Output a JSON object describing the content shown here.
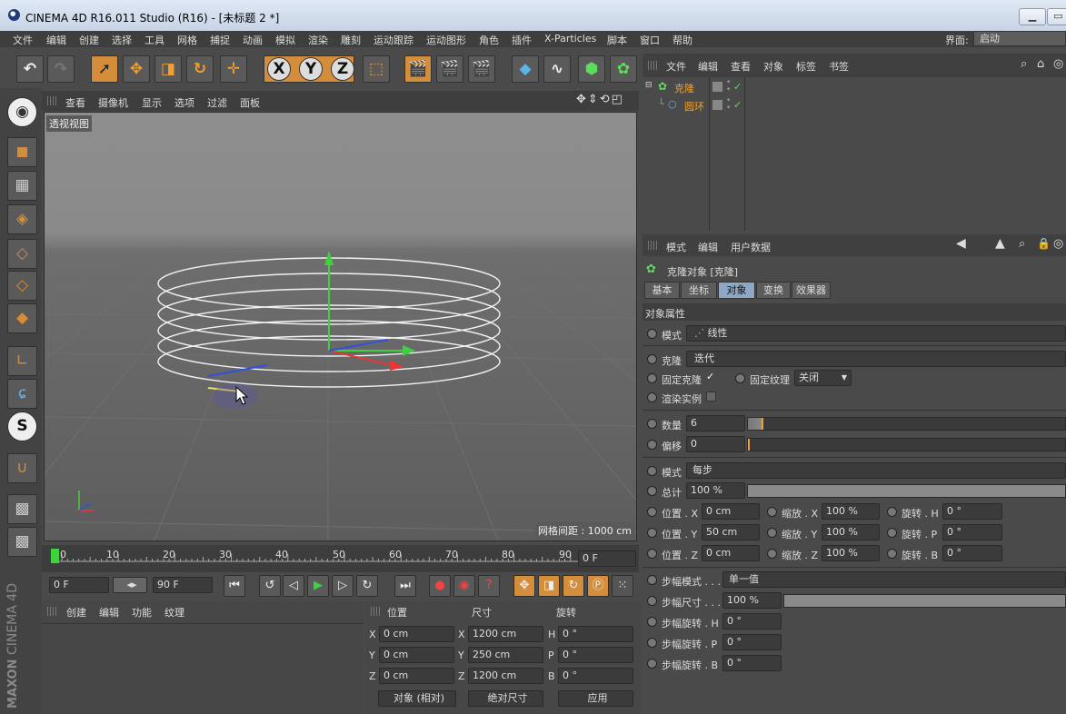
{
  "window": {
    "title": "CINEMA 4D R16.011 Studio (R16) - [未标题 2 *]"
  },
  "menubar": {
    "items": [
      "文件",
      "编辑",
      "创建",
      "选择",
      "工具",
      "网格",
      "捕捉",
      "动画",
      "模拟",
      "渲染",
      "雕刻",
      "运动跟踪",
      "运动图形",
      "角色",
      "插件",
      "X-Particles",
      "脚本",
      "窗口",
      "帮助"
    ],
    "layout_label": "界面:",
    "layout_value": "启动"
  },
  "toolbar": {
    "x": "X",
    "y": "Y",
    "z": "Z"
  },
  "sidebar": {
    "s_label": "S"
  },
  "viewport": {
    "menu": [
      "查看",
      "摄像机",
      "显示",
      "选项",
      "过滤",
      "面板"
    ],
    "view_name": "透视视图",
    "grid_info": "网格间距 : 1000 cm"
  },
  "timeline": {
    "ticks": [
      "0",
      "10",
      "20",
      "30",
      "40",
      "50",
      "60",
      "70",
      "80",
      "90"
    ],
    "current_frame": "0 F"
  },
  "playback": {
    "start": "0 F",
    "end": "90 F"
  },
  "materials": {
    "menu": [
      "创建",
      "编辑",
      "功能",
      "纹理"
    ]
  },
  "coords": {
    "headers": [
      "位置",
      "尺寸",
      "旋转"
    ],
    "rows": [
      {
        "axis": "X",
        "pos": "0 cm",
        "size_axis": "X",
        "size": "1200 cm",
        "rot_axis": "H",
        "rot": "0 °"
      },
      {
        "axis": "Y",
        "pos": "0 cm",
        "size_axis": "Y",
        "size": "250 cm",
        "rot_axis": "P",
        "rot": "0 °"
      },
      {
        "axis": "Z",
        "pos": "0 cm",
        "size_axis": "Z",
        "size": "1200 cm",
        "rot_axis": "B",
        "rot": "0 °"
      }
    ],
    "mode": "对象 (相对)",
    "size_mode": "绝对尺寸",
    "apply": "应用"
  },
  "objects": {
    "menu": [
      "文件",
      "编辑",
      "查看",
      "对象",
      "标签",
      "书签"
    ],
    "items": [
      {
        "name": "克隆"
      },
      {
        "name": "圆环"
      }
    ]
  },
  "attributes": {
    "menu": [
      "模式",
      "编辑",
      "用户数据"
    ],
    "object_title": "克隆对象 [克隆]",
    "tabs": [
      "基本",
      "坐标",
      "对象",
      "变换",
      "效果器"
    ],
    "active_tab": "对象",
    "section": "对象属性",
    "mode_label": "模式",
    "mode_value": "线性",
    "clone_label": "克隆",
    "clone_value": "迭代",
    "fix_clone": "固定克隆",
    "fix_clone_check": "✓",
    "fix_texture": "固定纹理",
    "fix_texture_value": "关闭",
    "render_instances": "渲染实例",
    "count_label": "数量",
    "count_value": "6",
    "count_fill": 0.05,
    "offset_label": "偏移",
    "offset_value": "0",
    "mode2_label": "模式",
    "mode2_value": "每步",
    "total_label": "总计",
    "total_value": "100 %",
    "pos_x_label": "位置 . X",
    "pos_x": "0 cm",
    "scale_x_label": "缩放 . X",
    "scale_x": "100 %",
    "rot_h_label": "旋转 . H",
    "rot_h": "0 °",
    "pos_y_label": "位置 . Y",
    "pos_y": "50 cm",
    "scale_y_label": "缩放 . Y",
    "scale_y": "100 %",
    "rot_p_label": "旋转 . P",
    "rot_p": "0 °",
    "pos_z_label": "位置 . Z",
    "pos_z": "0 cm",
    "scale_z_label": "缩放 . Z",
    "scale_z": "100 %",
    "rot_b_label": "旋转 . B",
    "rot_b": "0 °",
    "step_mode_label": "步幅模式 . . .",
    "step_mode_value": "单一值",
    "step_size_label": "步幅尺寸 . . .",
    "step_size_value": "100 %",
    "step_rot_h_label": "步幅旋转 . H",
    "step_rot_h": "0 °",
    "step_rot_p_label": "步幅旋转 . P",
    "step_rot_p": "0 °",
    "step_rot_b_label": "步幅旋转 . B",
    "step_rot_b": "0 °"
  },
  "brand": {
    "line1": "MAXON",
    "line2": "CINEMA 4D"
  }
}
